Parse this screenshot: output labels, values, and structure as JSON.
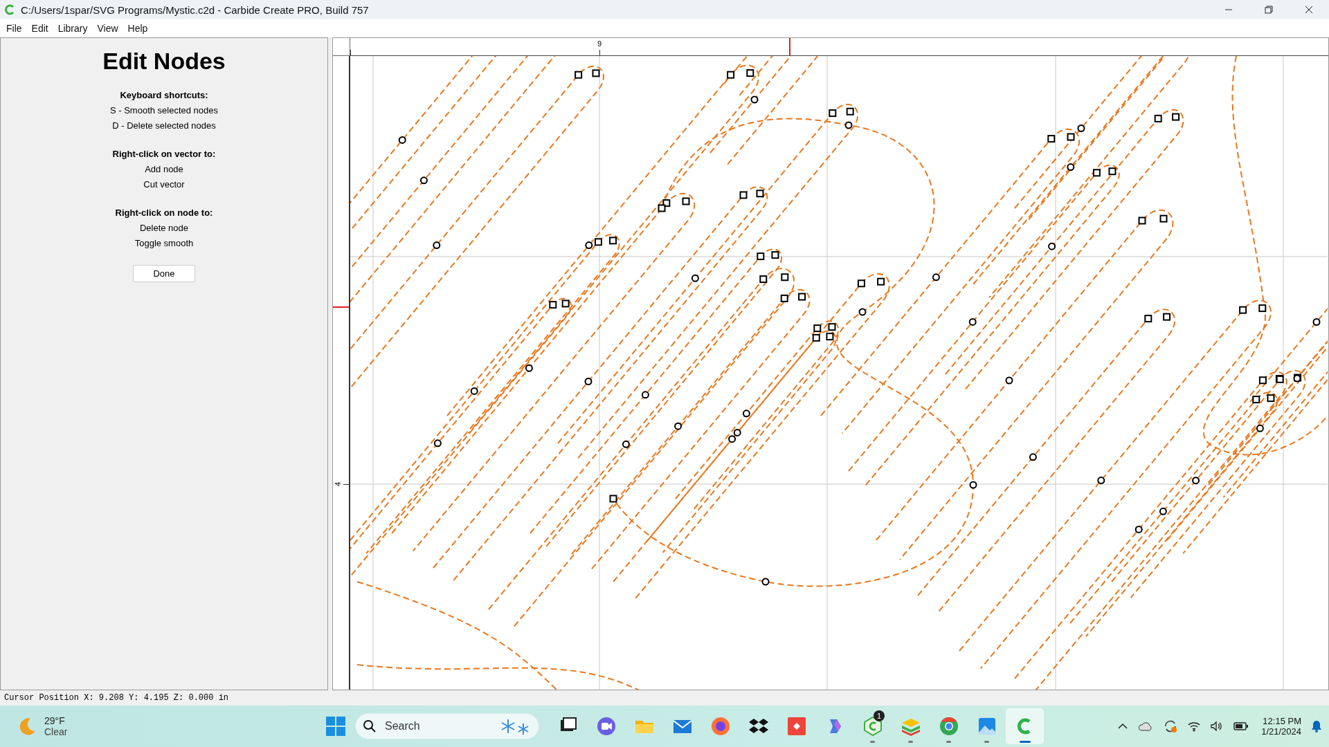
{
  "window": {
    "title": "C:/Users/1spar/SVG Programs/Mystic.c2d - Carbide Create PRO, Build 757"
  },
  "menu": [
    "File",
    "Edit",
    "Library",
    "View",
    "Help"
  ],
  "panel": {
    "heading": "Edit Nodes",
    "sections": [
      {
        "title": "Keyboard shortcuts:",
        "lines": [
          "S - Smooth selected nodes",
          "D - Delete selected nodes"
        ]
      },
      {
        "title": "Right-click on vector to:",
        "lines": [
          "Add node",
          "Cut vector"
        ]
      },
      {
        "title": "Right-click on node to:",
        "lines": [
          "Delete node",
          "Toggle smooth"
        ]
      }
    ],
    "button": "Done"
  },
  "canvas": {
    "top_ruler_labels": [
      "9"
    ],
    "left_ruler_labels": [
      "4"
    ]
  },
  "status_bar": "Cursor Position X: 9.208 Y: 4.195 Z: 0.000 in",
  "taskbar": {
    "weather": {
      "temperature": "29°F",
      "condition": "Clear"
    },
    "search": {
      "placeholder": "Search"
    },
    "apps": [
      {
        "kind": "taskview",
        "running": false,
        "selected": false
      },
      {
        "kind": "meet",
        "running": false,
        "selected": false
      },
      {
        "kind": "folder",
        "running": false,
        "selected": false
      },
      {
        "kind": "mail",
        "running": false,
        "selected": false
      },
      {
        "kind": "firefox",
        "running": false,
        "selected": false
      },
      {
        "kind": "dropbox",
        "running": false,
        "selected": false
      },
      {
        "kind": "remote",
        "running": false,
        "selected": false
      },
      {
        "kind": "copilot",
        "running": false,
        "selected": false
      },
      {
        "kind": "carbide-alt",
        "running": true,
        "selected": false,
        "badge": "1"
      },
      {
        "kind": "stack",
        "running": true,
        "selected": false
      },
      {
        "kind": "chrome",
        "running": true,
        "selected": false
      },
      {
        "kind": "photos",
        "running": true,
        "selected": false
      },
      {
        "kind": "carbide",
        "running": true,
        "selected": true
      }
    ],
    "time": "12:15 PM",
    "date": "1/21/2024"
  }
}
